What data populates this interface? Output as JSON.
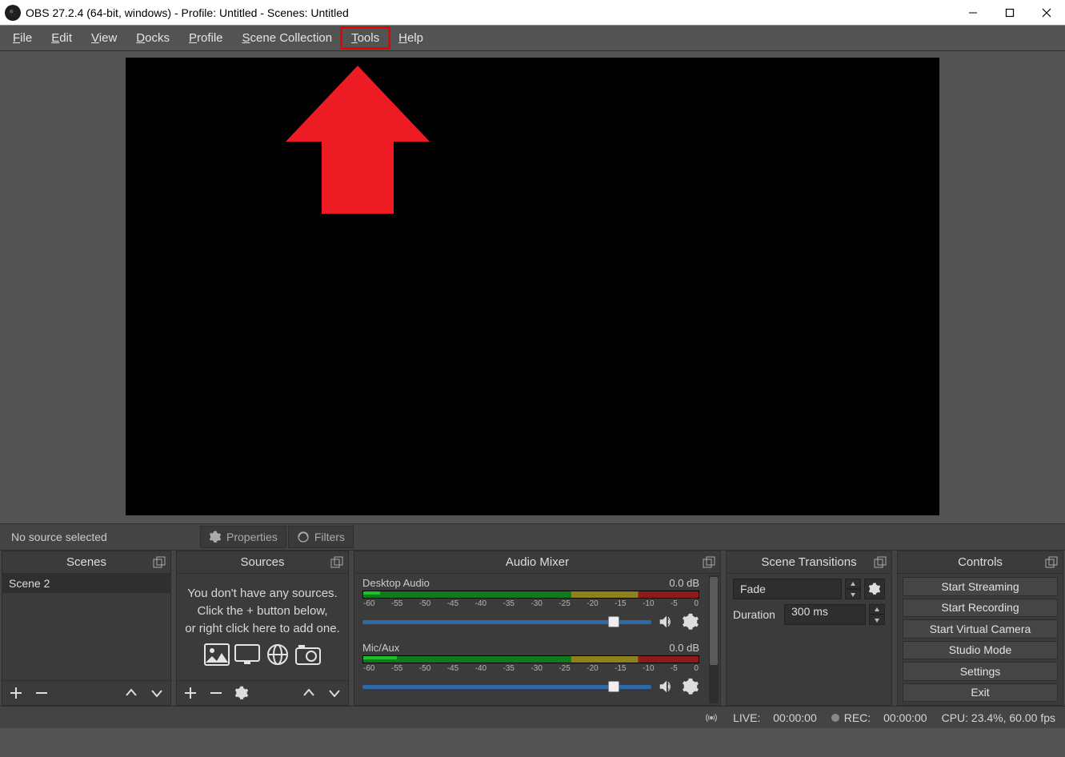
{
  "titlebar": {
    "title": "OBS 27.2.4 (64-bit, windows) - Profile: Untitled - Scenes: Untitled"
  },
  "menu": {
    "file": "File",
    "edit": "Edit",
    "view": "View",
    "docks": "Docks",
    "profile": "Profile",
    "scene_collection": "Scene Collection",
    "tools": "Tools",
    "help": "Help"
  },
  "props_bar": {
    "no_source": "No source selected",
    "properties": "Properties",
    "filters": "Filters"
  },
  "docks": {
    "scenes": {
      "title": "Scenes",
      "item": "Scene 2"
    },
    "sources": {
      "title": "Sources",
      "empty_l1": "You don't have any sources.",
      "empty_l2": "Click the + button below,",
      "empty_l3": "or right click here to add one."
    },
    "mixer": {
      "title": "Audio Mixer",
      "ch1_name": "Desktop Audio",
      "ch1_db": "0.0 dB",
      "ch2_name": "Mic/Aux",
      "ch2_db": "0.0 dB",
      "ticks": [
        "-60",
        "-55",
        "-50",
        "-45",
        "-40",
        "-35",
        "-30",
        "-25",
        "-20",
        "-15",
        "-10",
        "-5",
        "0"
      ]
    },
    "transitions": {
      "title": "Scene Transitions",
      "selected": "Fade",
      "duration_label": "Duration",
      "duration_value": "300 ms"
    },
    "controls": {
      "title": "Controls",
      "start_streaming": "Start Streaming",
      "start_recording": "Start Recording",
      "virtual_camera": "Start Virtual Camera",
      "studio_mode": "Studio Mode",
      "settings": "Settings",
      "exit": "Exit"
    }
  },
  "status": {
    "live_label": "LIVE:",
    "live_time": "00:00:00",
    "rec_label": "REC:",
    "rec_time": "00:00:00",
    "cpu": "CPU: 23.4%, 60.00 fps"
  }
}
